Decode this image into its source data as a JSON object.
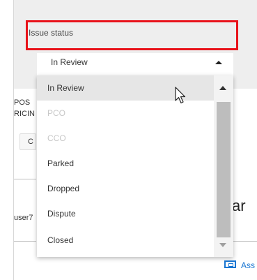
{
  "issue_status": {
    "label": "Issue status",
    "selected_value": "In Review"
  },
  "dropdown": {
    "options": [
      {
        "label": "In Review",
        "state": "selected"
      },
      {
        "label": "PCO",
        "state": "disabled"
      },
      {
        "label": "CCO",
        "state": "disabled"
      },
      {
        "label": "Parked",
        "state": "enabled"
      },
      {
        "label": "Dropped",
        "state": "enabled"
      },
      {
        "label": "Dispute",
        "state": "enabled"
      },
      {
        "label": "Closed",
        "state": "enabled"
      }
    ]
  },
  "background": {
    "text_1": "POS",
    "text_2": "RICIN",
    "tab_text": "C",
    "user_text": "user7",
    "big_text": "ar",
    "assign_text": "Ass"
  },
  "colors": {
    "highlight_border": "#e8131a",
    "link_blue": "#1976d2",
    "panel_bg": "#eeeeee"
  },
  "icons": {
    "caret": "caret-up-icon",
    "assign": "assign-icon",
    "cursor": "mouse-pointer-icon"
  }
}
